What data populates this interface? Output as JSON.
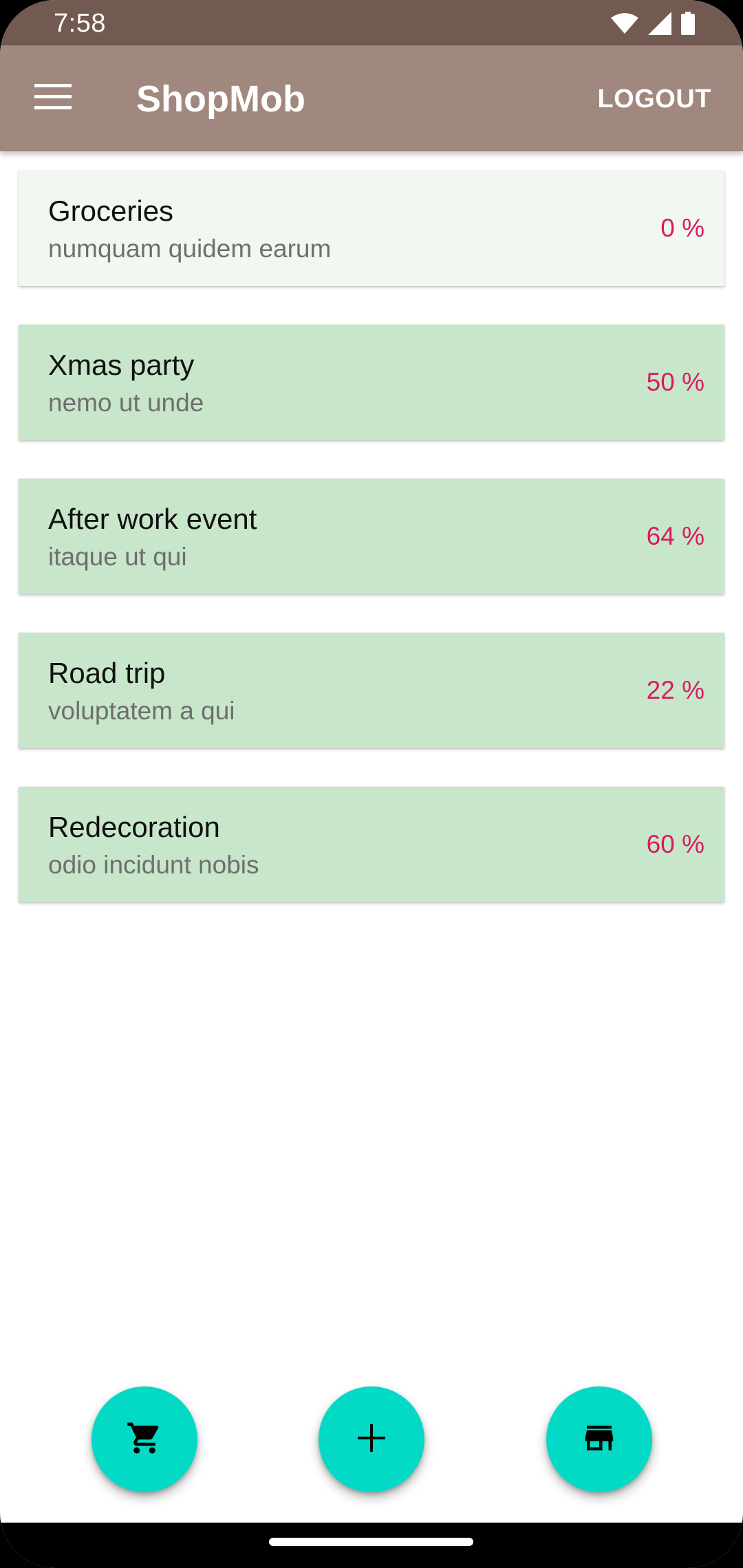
{
  "status_bar": {
    "time": "7:58",
    "icons": [
      "wifi-icon",
      "signal-icon",
      "battery-icon"
    ]
  },
  "app_bar": {
    "menu_icon": "menu-icon",
    "title": "ShopMob",
    "logout_label": "LOGOUT"
  },
  "lists": [
    {
      "title": "Groceries",
      "subtitle": "numquam quidem earum",
      "progress": "0 %",
      "progress_value": 0
    },
    {
      "title": "Xmas party",
      "subtitle": "nemo ut unde",
      "progress": "50 %",
      "progress_value": 50
    },
    {
      "title": "After work event",
      "subtitle": "itaque ut qui",
      "progress": "64 %",
      "progress_value": 64
    },
    {
      "title": "Road trip",
      "subtitle": "voluptatem a qui",
      "progress": "22 %",
      "progress_value": 22
    },
    {
      "title": "Redecoration",
      "subtitle": "odio incidunt nobis",
      "progress": "60 %",
      "progress_value": 60
    }
  ],
  "fabs": {
    "cart_icon": "shopping-cart-icon",
    "add_icon": "add-icon",
    "store_icon": "store-icon"
  },
  "colors": {
    "status_bar": "#735a50",
    "app_bar": "#a1887f",
    "list_item": "#c8e6c9",
    "list_item_highlight": "#f1f8f1",
    "progress_text": "#d81b60",
    "fab": "#03dac5"
  }
}
